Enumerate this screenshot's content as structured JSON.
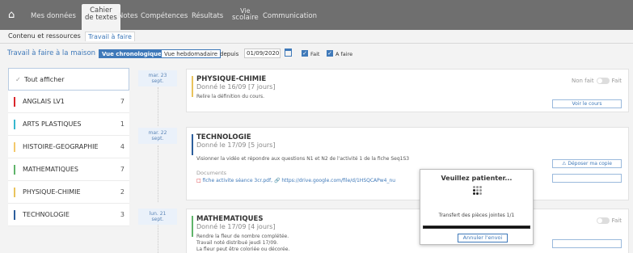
{
  "nav": {
    "home_icon": "home-icon",
    "items": [
      {
        "label": "Mes données"
      },
      {
        "label_top": "Cahier",
        "label_bottom": "de textes"
      },
      {
        "label": "Notes"
      },
      {
        "label": "Compétences"
      },
      {
        "label": "Résultats"
      },
      {
        "label_top": "Vie",
        "label_bottom": "scolaire"
      },
      {
        "label": "Communication"
      }
    ]
  },
  "subtabs": [
    "Contenu et ressources",
    "Travail à faire"
  ],
  "filter": {
    "title": "Travail à faire à la maison",
    "vue_chrono": "Vue chronologique",
    "vue_hebdo": "Vue hebdomadaire",
    "depuis": "depuis",
    "date": "01/09/2020",
    "fait": "Fait",
    "a_faire": "A faire"
  },
  "subjects": [
    {
      "name": "Tout afficher",
      "count": "",
      "color": ""
    },
    {
      "name": "ANGLAIS LV1",
      "count": "7",
      "color": "#d9262b"
    },
    {
      "name": "ARTS PLASTIQUES",
      "count": "1",
      "color": "#37b7cf"
    },
    {
      "name": "HISTOIRE-GEOGRAPHIE",
      "count": "4",
      "color": "#f3c96b"
    },
    {
      "name": "MATHEMATIQUES",
      "count": "7",
      "color": "#5fb46a"
    },
    {
      "name": "PHYSIQUE-CHIMIE",
      "count": "2",
      "color": "#e9c35c"
    },
    {
      "name": "TECHNOLOGIE",
      "count": "3",
      "color": "#2c5e9c"
    }
  ],
  "dates": [
    {
      "day": "mar. 23",
      "month": "sept."
    },
    {
      "day": "mar. 22",
      "month": "sept."
    },
    {
      "day": "lun. 21",
      "month": "sept."
    }
  ],
  "cards": [
    {
      "title": "PHYSIQUE-CHIMIE",
      "given": "Donné le 16/09 [7 jours]",
      "lines": [
        "Relire la définition du cours."
      ],
      "non_fait": "Non fait",
      "fait": "Fait",
      "button": "Voir le cours",
      "color": "#e9c35c"
    },
    {
      "title": "TECHNOLOGIE",
      "given": "Donné le 17/09 [5 jours]",
      "lines": [
        "Visionner la vidéo et répondre aux questions N1 et N2 de l'activité 1 de la fiche Seq1S3"
      ],
      "documents": "Documents",
      "doc_file": "fiche activite séance 3cr.pdf,",
      "doc_link": "https://drive.google.com/file/d/1HSQCAPw4_nu",
      "button": "⚠ Déposer ma copie",
      "color": "#2c5e9c"
    },
    {
      "title": "MATHEMATIQUES",
      "given": "Donné le 17/09 [4 jours]",
      "lines": [
        "Rendre la fleur de nombre complétée.",
        "Travail noté distribué jeudi 17/09.",
        "La fleur peut être coloriée ou décorée."
      ],
      "fait": "Fait",
      "color": "#5fb46a"
    }
  ],
  "modal": {
    "title": "Veuillez patienter...",
    "text": "Transfert des pièces jointes 1/1",
    "progress": 1.0,
    "cancel": "Annuler l'envoi"
  }
}
